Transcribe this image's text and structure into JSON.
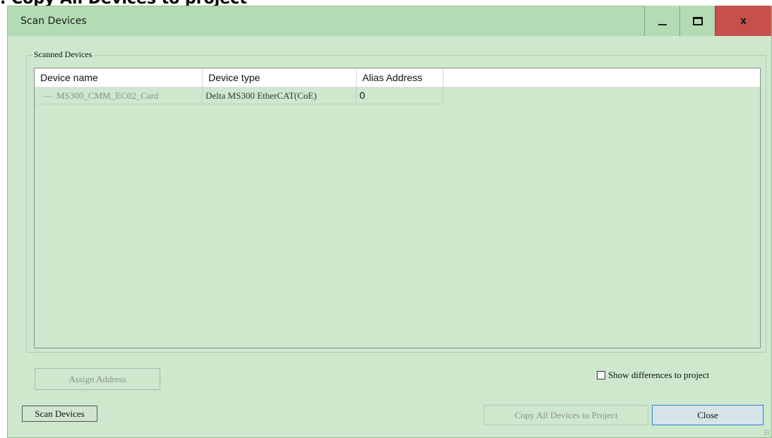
{
  "background_heading": ". Copy All Devices to project",
  "window": {
    "title": "Scan Devices",
    "close_glyph": "x"
  },
  "group": {
    "label": "Scanned Devices"
  },
  "grid": {
    "columns": [
      "Device name",
      "Device type",
      "Alias Address"
    ],
    "rows": [
      {
        "name": "MS300_CMM_EC02_Card",
        "type": "Delta MS300 EtherCAT(CoE)",
        "alias": "0"
      }
    ]
  },
  "buttons": {
    "assign_address": "Assign Address",
    "scan_devices": "Scan Devices",
    "copy_all": "Copy All Devices to Project",
    "close": "Close"
  },
  "checkbox": {
    "label": "Show differences to project",
    "checked": false
  },
  "colors": {
    "title_bar": "#b4dcb4",
    "client": "#cde8cd",
    "close_button": "#c8504a",
    "default_button_border": "#2f7fd8"
  },
  "icons": {
    "minimize": "minimize-icon",
    "maximize": "maximize-icon",
    "close": "close-icon"
  }
}
